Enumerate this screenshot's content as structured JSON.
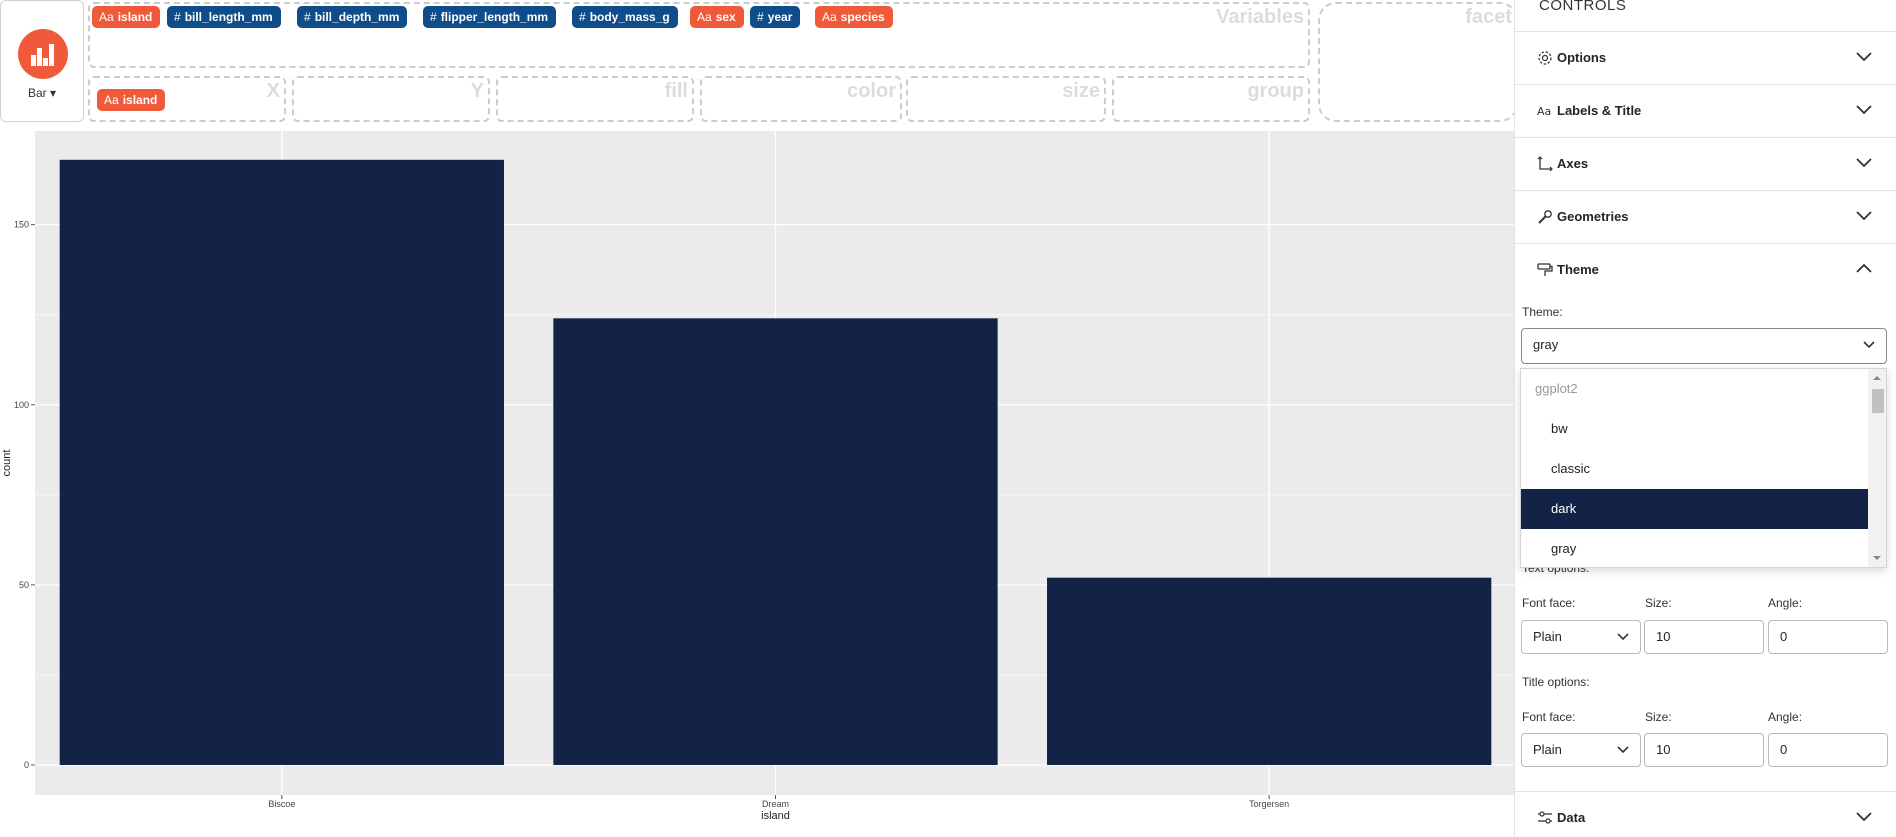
{
  "geom": {
    "label": "Bar ▾"
  },
  "variables_zone": {
    "label": "Variables"
  },
  "facet_zone": {
    "label": "facet"
  },
  "variables": [
    {
      "name": "island",
      "type": "categorical",
      "icon": "Aa"
    },
    {
      "name": "bill_length_mm",
      "type": "numeric",
      "icon": "#"
    },
    {
      "name": "bill_depth_mm",
      "type": "numeric",
      "icon": "#"
    },
    {
      "name": "flipper_length_mm",
      "type": "numeric",
      "icon": "#"
    },
    {
      "name": "body_mass_g",
      "type": "numeric",
      "icon": "#"
    },
    {
      "name": "sex",
      "type": "categorical",
      "icon": "Aa"
    },
    {
      "name": "year",
      "type": "numeric",
      "icon": "#"
    },
    {
      "name": "species",
      "type": "categorical",
      "icon": "Aa"
    }
  ],
  "aesthetics": {
    "x": {
      "label": "X",
      "value": "island",
      "icon": "Aa"
    },
    "y": {
      "label": "Y"
    },
    "fill": {
      "label": "fill"
    },
    "color": {
      "label": "color"
    },
    "size": {
      "label": "size"
    },
    "group": {
      "label": "group"
    }
  },
  "chart_data": {
    "type": "bar",
    "categories": [
      "Biscoe",
      "Dream",
      "Torgersen"
    ],
    "values": [
      168,
      124,
      52
    ],
    "xlabel": "island",
    "ylabel": "count",
    "ylim": [
      0,
      176
    ],
    "yticks": [
      0,
      50,
      100,
      150
    ],
    "bar_color": "#132347",
    "panel_color": "#ebebeb",
    "grid": true
  },
  "controls": {
    "title": "CONTROLS",
    "sections": {
      "options": "Options",
      "labels": "Labels & Title",
      "axes": "Axes",
      "geometries": "Geometries",
      "theme": "Theme",
      "data": "Data"
    },
    "theme": {
      "label": "Theme:",
      "value": "gray",
      "dropdown_group": "ggplot2",
      "options": [
        "bw",
        "classic",
        "dark",
        "gray"
      ],
      "highlighted": "dark"
    },
    "text_options": {
      "label": "Text options:",
      "font_face_label": "Font face:",
      "font_face": "Plain",
      "size_label": "Size:",
      "size": "10",
      "angle_label": "Angle:",
      "angle": "0"
    },
    "title_options": {
      "label": "Title options:",
      "font_face_label": "Font face:",
      "font_face": "Plain",
      "size_label": "Size:",
      "size": "10",
      "angle_label": "Angle:",
      "angle": "0"
    }
  },
  "colors": {
    "accent": "#f05a3a",
    "numeric": "#0f4c8a",
    "selected": "#132347"
  }
}
